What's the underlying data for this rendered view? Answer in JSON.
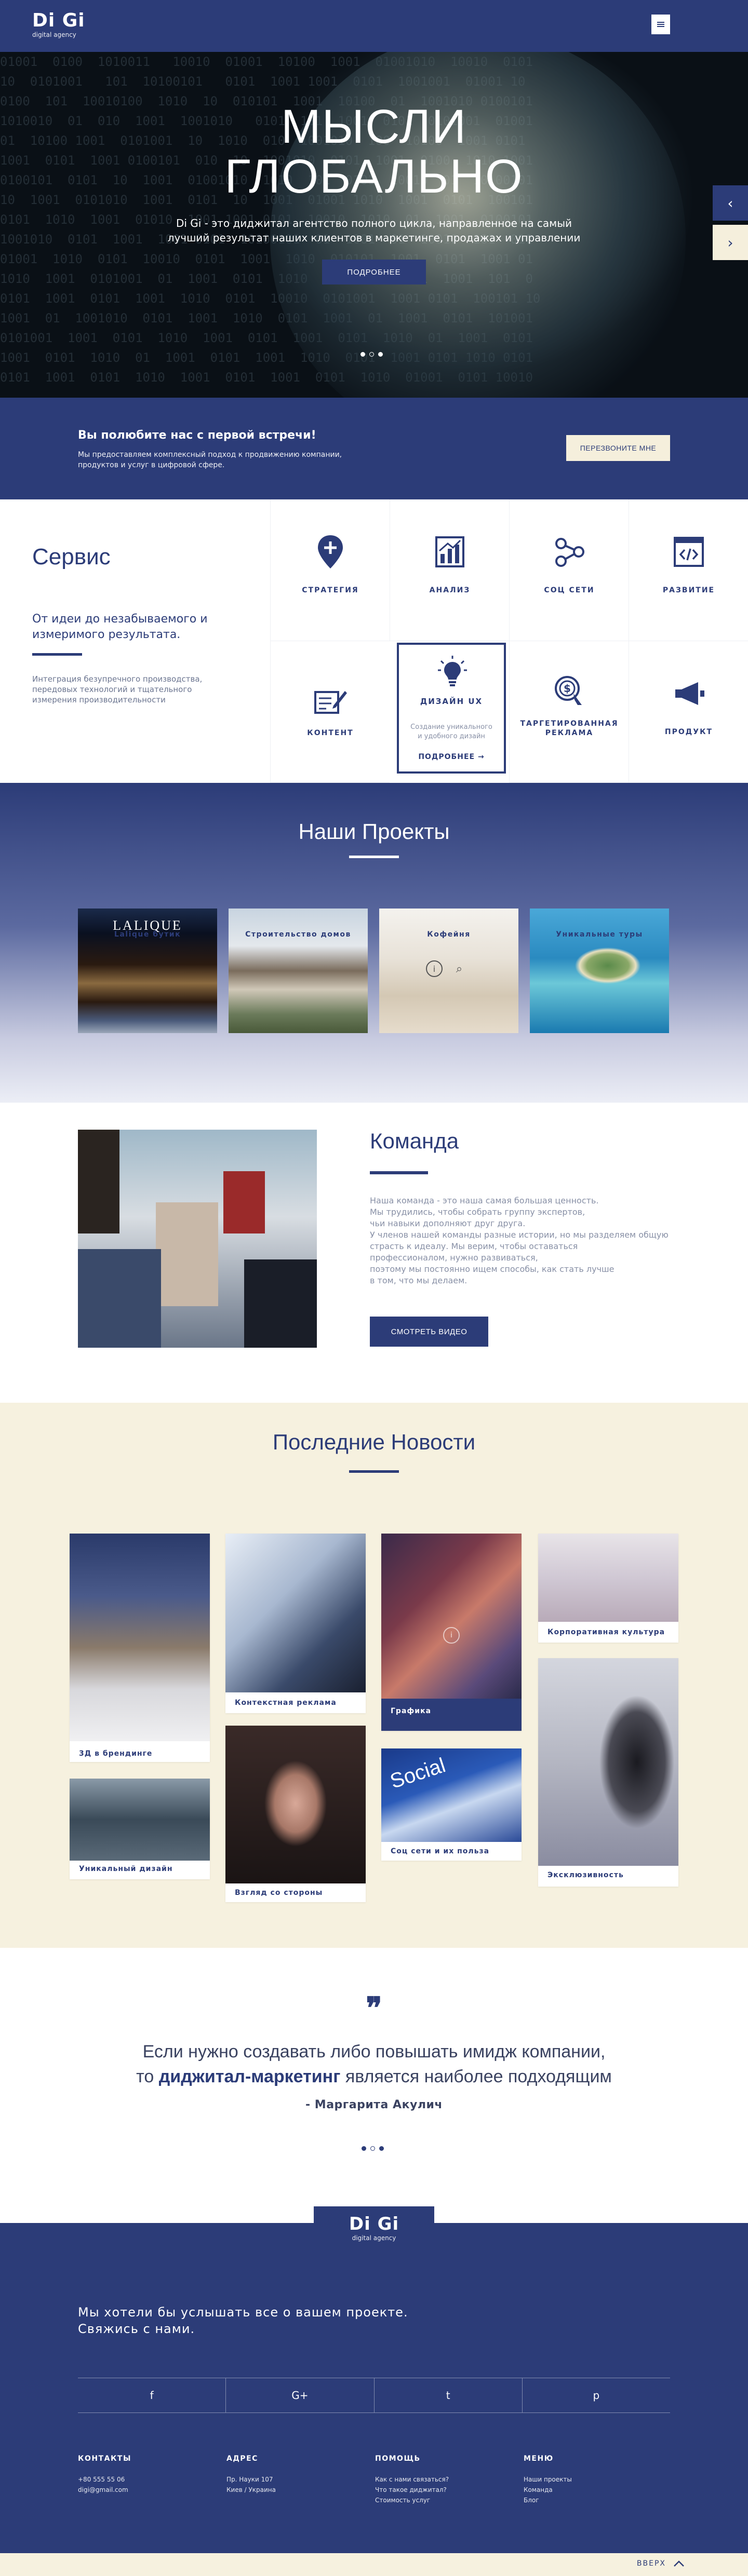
{
  "header": {
    "logo": "Di Gi",
    "logo_sub": "digital agency",
    "menu_icon": "hamburger-icon"
  },
  "hero": {
    "title_line1": "МЫСЛИ",
    "title_line2": "ГЛОБАЛЬНО",
    "text": "Di Gi - это диджитал агентство полного цикла, направленное на самый лучший результат наших клиентов в маркетинге, продажах и управлении",
    "button": "ПОДРОБНЕЕ",
    "prev_arrow": "‹",
    "next_arrow": "›"
  },
  "cta": {
    "title": "Вы полюбите нас с первой встречи!",
    "text": "Мы предоставляем комплексный подход к продвижению компании, продуктов и услуг в цифровой сфере.",
    "button": "ПЕРЕЗВОНИТЕ МНЕ"
  },
  "services": {
    "title": "Сервис",
    "subtitle": "От идеи до незабываемого и измеримого результата.",
    "description": "Интеграция безупречного производства, передовых технологий и тщательного измерения производительности",
    "items": [
      {
        "label": "СТРАТЕГИЯ",
        "icon": "strategy-icon"
      },
      {
        "label": "АНАЛИЗ",
        "icon": "analysis-icon"
      },
      {
        "label": "СОЦ СЕТИ",
        "icon": "share-icon"
      },
      {
        "label": "РАЗВИТИЕ",
        "icon": "code-icon"
      },
      {
        "label": "КОНТЕНТ",
        "icon": "content-icon"
      },
      {
        "label": "ТАРГЕТИРОВАННАЯ РЕКЛАМА",
        "icon": "targeted-ad-icon"
      },
      {
        "label": "ПРОДУКТ",
        "icon": "megaphone-icon"
      }
    ],
    "active": {
      "label": "ДИЗАЙН UX",
      "text": "Создание уникального и удобного дизайн",
      "link": "ПОДРОБНЕЕ →",
      "icon": "lightbulb-icon"
    }
  },
  "projects": {
    "title": "Наши Проекты",
    "items": [
      {
        "label": "Lalique бутик"
      },
      {
        "label": "Строительство домов"
      },
      {
        "label": "Кофейня"
      },
      {
        "label": "Уникальные туры"
      }
    ]
  },
  "team": {
    "title": "Команда",
    "text": "Наша команда - это наша самая большая ценность.\nМы трудились, чтобы собрать группу  экспертов,\n чьи навыки дополняют друг друга.\nУ членов нашей команды разные истории, но мы разделяем общую\nстрасть к идеалу. Мы верим, чтобы оставаться\nпрофессионалом, нужно развиваться,\nпоэтому мы постоянно ищем способы, как стать лучше\nв том, что мы делаем.",
    "button": "СМОТРЕТЬ ВИДЕО"
  },
  "news": {
    "title": "Последние Новости",
    "items": [
      {
        "label": "3Д в брендинге"
      },
      {
        "label": "Уникальный дизайн"
      },
      {
        "label": "Контекстная реклама"
      },
      {
        "label": "Взгляд со стороны"
      },
      {
        "label": "Графика"
      },
      {
        "label": "Соц сети и их польза"
      },
      {
        "label": "Корпоративная культура"
      },
      {
        "label": "Эксклюзивность"
      }
    ]
  },
  "quote": {
    "mark": "❞",
    "line1": "Если нужно создавать либо повышать имидж компании,",
    "line2_pre": "то ",
    "line2_bold": "диджитал-маркетинг",
    "line2_post": " является наиболее подходящим",
    "author": "- Маргарита Акулич"
  },
  "footer": {
    "logo": "Di Gi",
    "logo_sub": "digital agency",
    "contact_line1": "Мы хотели бы услышать все о вашем проекте.",
    "contact_line2": "Свяжись с нами.",
    "social": [
      "f",
      "G+",
      "t",
      "p"
    ],
    "cols": [
      {
        "title": "КОНТАКТЫ",
        "lines": [
          "+80 555 55 06",
          "digi@gmail.com"
        ]
      },
      {
        "title": "АДРЕС",
        "lines": [
          "Пр. Науки 107",
          "Киев / Украина"
        ]
      },
      {
        "title": "ПОМОЩЬ",
        "lines": [
          "Как с нами связаться?",
          "Что такое диджитал?",
          "Стоимость услуг"
        ]
      },
      {
        "title": "МЕНЮ",
        "lines": [
          "Наши проекты",
          "Команда",
          "Блог"
        ]
      }
    ]
  },
  "bottom": {
    "up": "ВВЕРХ"
  }
}
